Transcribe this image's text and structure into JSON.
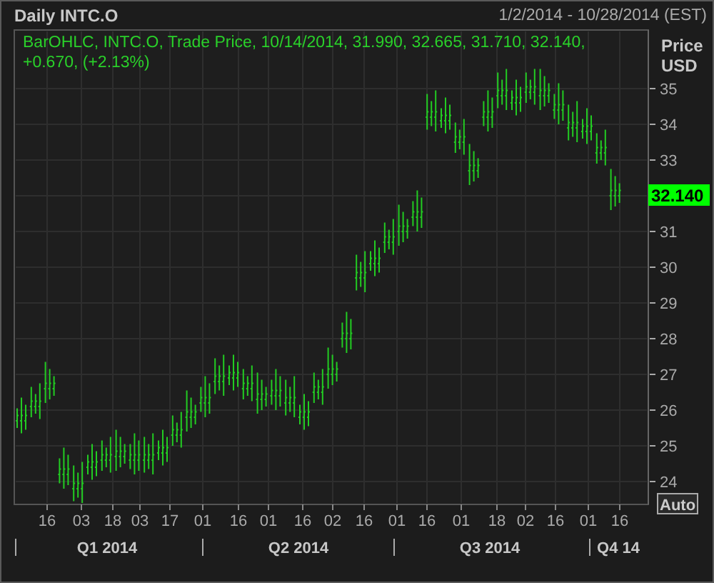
{
  "header": {
    "title": "Daily INTC.O",
    "date_range": "1/2/2014 - 10/28/2014 (EST)"
  },
  "legend": "BarOHLC, INTC.O, Trade Price,  10/14/2014, 31.990, 32.665, 31.710, 32.140, +0.670, (+2.13%)",
  "axis_title": [
    "Price",
    "USD"
  ],
  "y_labels": [
    "35",
    "34",
    "33",
    "31",
    "30",
    "29",
    "28",
    "27",
    "26",
    "25",
    "24"
  ],
  "last_price": "32.140",
  "auto_button": "Auto",
  "day_labels": [
    "16",
    "03",
    "18",
    "03",
    "17",
    "01",
    "16",
    "01",
    "16",
    "02",
    "16",
    "01",
    "16",
    "01",
    "18",
    "02",
    "16",
    "01",
    "16"
  ],
  "quarters": [
    "Q1 2014",
    "Q2 2014",
    "Q3 2014",
    "Q4 14"
  ]
}
